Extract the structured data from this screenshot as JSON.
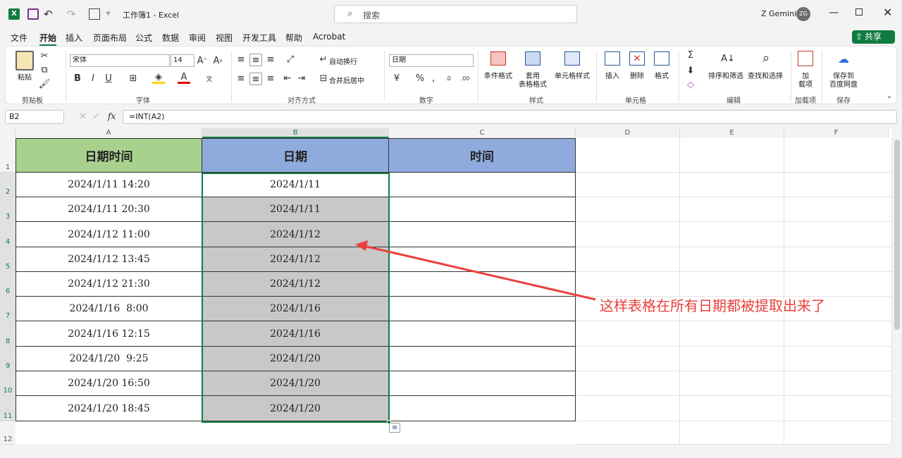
{
  "titlebar": {
    "doc_title": "工作簿1 - Excel",
    "search_placeholder": "搜索",
    "user": "Z Gemini",
    "avatar": "ZG"
  },
  "menu": [
    "文件",
    "开始",
    "插入",
    "页面布局",
    "公式",
    "数据",
    "审阅",
    "视图",
    "开发工具",
    "帮助",
    "Acrobat"
  ],
  "share_label": "共享",
  "ribbon": {
    "paste": "粘贴",
    "clipboard": "剪贴板",
    "font_name": "宋体",
    "font_size": "14",
    "font_group": "字体",
    "wrap": "自动换行",
    "merge": "合并后居中",
    "align_group": "对齐方式",
    "num_format": "日期",
    "number_group": "数字",
    "cond": "条件格式",
    "table_fmt1": "套用",
    "table_fmt2": "表格格式",
    "cell_style": "单元格样式",
    "styles_group": "样式",
    "insert": "插入",
    "delete": "删除",
    "format": "格式",
    "cells_group": "单元格",
    "sort": "排序和筛选",
    "find": "查找和选择",
    "edit_group": "编辑",
    "addin1": "加",
    "addin2": "载项",
    "addin_group": "加载项",
    "save1": "保存到",
    "save2": "百度网盘",
    "save_group": "保存",
    "bold": "B",
    "italic": "I",
    "underline": "U"
  },
  "formula_bar": {
    "name_box": "B2",
    "fx": "fx",
    "formula": "=INT(A2)"
  },
  "columns": [
    "A",
    "B",
    "C",
    "D",
    "E",
    "F"
  ],
  "rows": [
    "1",
    "2",
    "3",
    "4",
    "5",
    "6",
    "7",
    "8",
    "9",
    "10",
    "11",
    "12"
  ],
  "headers": {
    "a": "日期时间",
    "b": "日期",
    "c": "时间"
  },
  "data": [
    {
      "a": "2024/1/11 14:20",
      "b": "2024/1/11"
    },
    {
      "a": "2024/1/11 20:30",
      "b": "2024/1/11"
    },
    {
      "a": "2024/1/12 11:00",
      "b": "2024/1/12"
    },
    {
      "a": "2024/1/12 13:45",
      "b": "2024/1/12"
    },
    {
      "a": "2024/1/12 21:30",
      "b": "2024/1/12"
    },
    {
      "a": "2024/1/16  8:00",
      "b": "2024/1/16"
    },
    {
      "a": "2024/1/16 12:15",
      "b": "2024/1/16"
    },
    {
      "a": "2024/1/20  9:25",
      "b": "2024/1/20"
    },
    {
      "a": "2024/1/20 16:50",
      "b": "2024/1/20"
    },
    {
      "a": "2024/1/20 18:45",
      "b": "2024/1/20"
    }
  ],
  "annotation": "这样表格在所有日期都被提取出来了",
  "colors": {
    "excel_green": "#107c41",
    "header_a": "#a9d18e",
    "header_bc": "#8faadc",
    "selected_fill": "#c8c8c8",
    "arrow": "#e8413c"
  }
}
